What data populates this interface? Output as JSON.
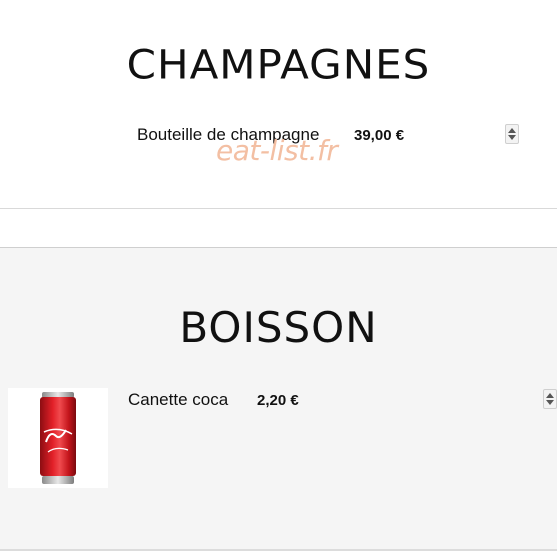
{
  "sections": [
    {
      "title": "CHAMPAGNES",
      "items": [
        {
          "name": "Bouteille de champagne",
          "price": "39,00 €"
        }
      ]
    },
    {
      "title": "BOISSON",
      "items": [
        {
          "name": "Canette coca",
          "price": "2,20 €",
          "image_icon": "coca-cola-can"
        }
      ]
    }
  ],
  "watermark": "eat-list.fr",
  "colors": {
    "watermark": "#f2b99a",
    "section_bg_alt": "#f5f5f5",
    "can_red": "#d8181f"
  }
}
